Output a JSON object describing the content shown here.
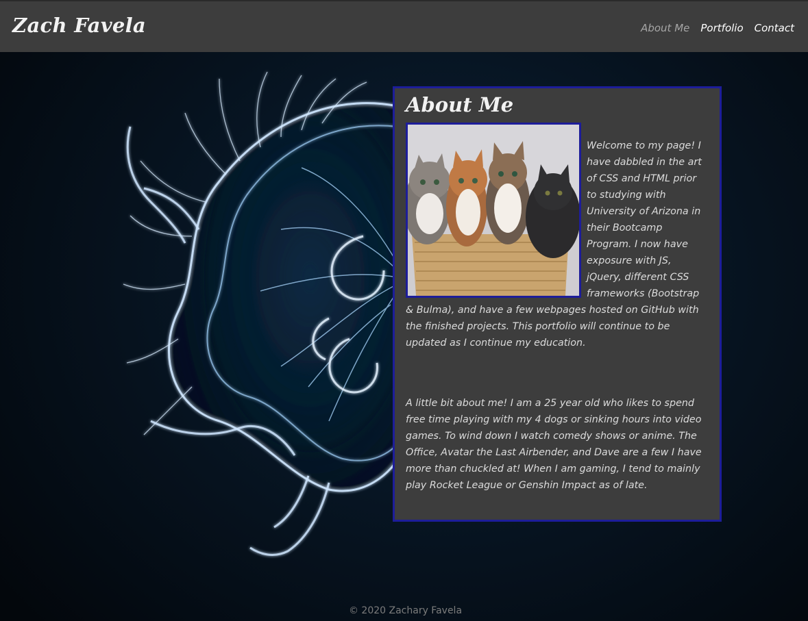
{
  "header": {
    "brand": "Zach Favela",
    "nav": [
      {
        "label": "About Me",
        "active": true
      },
      {
        "label": "Portfolio",
        "active": false
      },
      {
        "label": "Contact",
        "active": false
      }
    ]
  },
  "about": {
    "title": "About Me",
    "photo_icon": "kittens-in-basket-photo",
    "paragraph_1": "Welcome to my page! I have dabbled in the art of CSS and HTML prior to studying with University of Arizona in their Bootcamp Program. I now have exposure with JS, jQuery, different CSS frameworks (Bootstrap & Bulma), and have a few webpages hosted on GitHub with the finished projects. This portfolio will continue to be updated as I continue my education.",
    "paragraph_2": "A little bit about me! I am a 25 year old who likes to spend free time playing with my 4 dogs or sinking hours into video games. To wind down I watch comedy shows or anime. The Office, Avatar the Last Airbender, and Dave are a few I have more than chuckled at! When I am gaming, I tend to mainly play Rocket League or Genshin Impact as of late."
  },
  "footer": {
    "copyright": "© 2020 Zachary Favela"
  },
  "colors": {
    "navbar": "#3d3d3d",
    "card_bg": "#3d3d3d",
    "card_border": "#1d1d9a",
    "active_link": "#a6a6a6"
  }
}
